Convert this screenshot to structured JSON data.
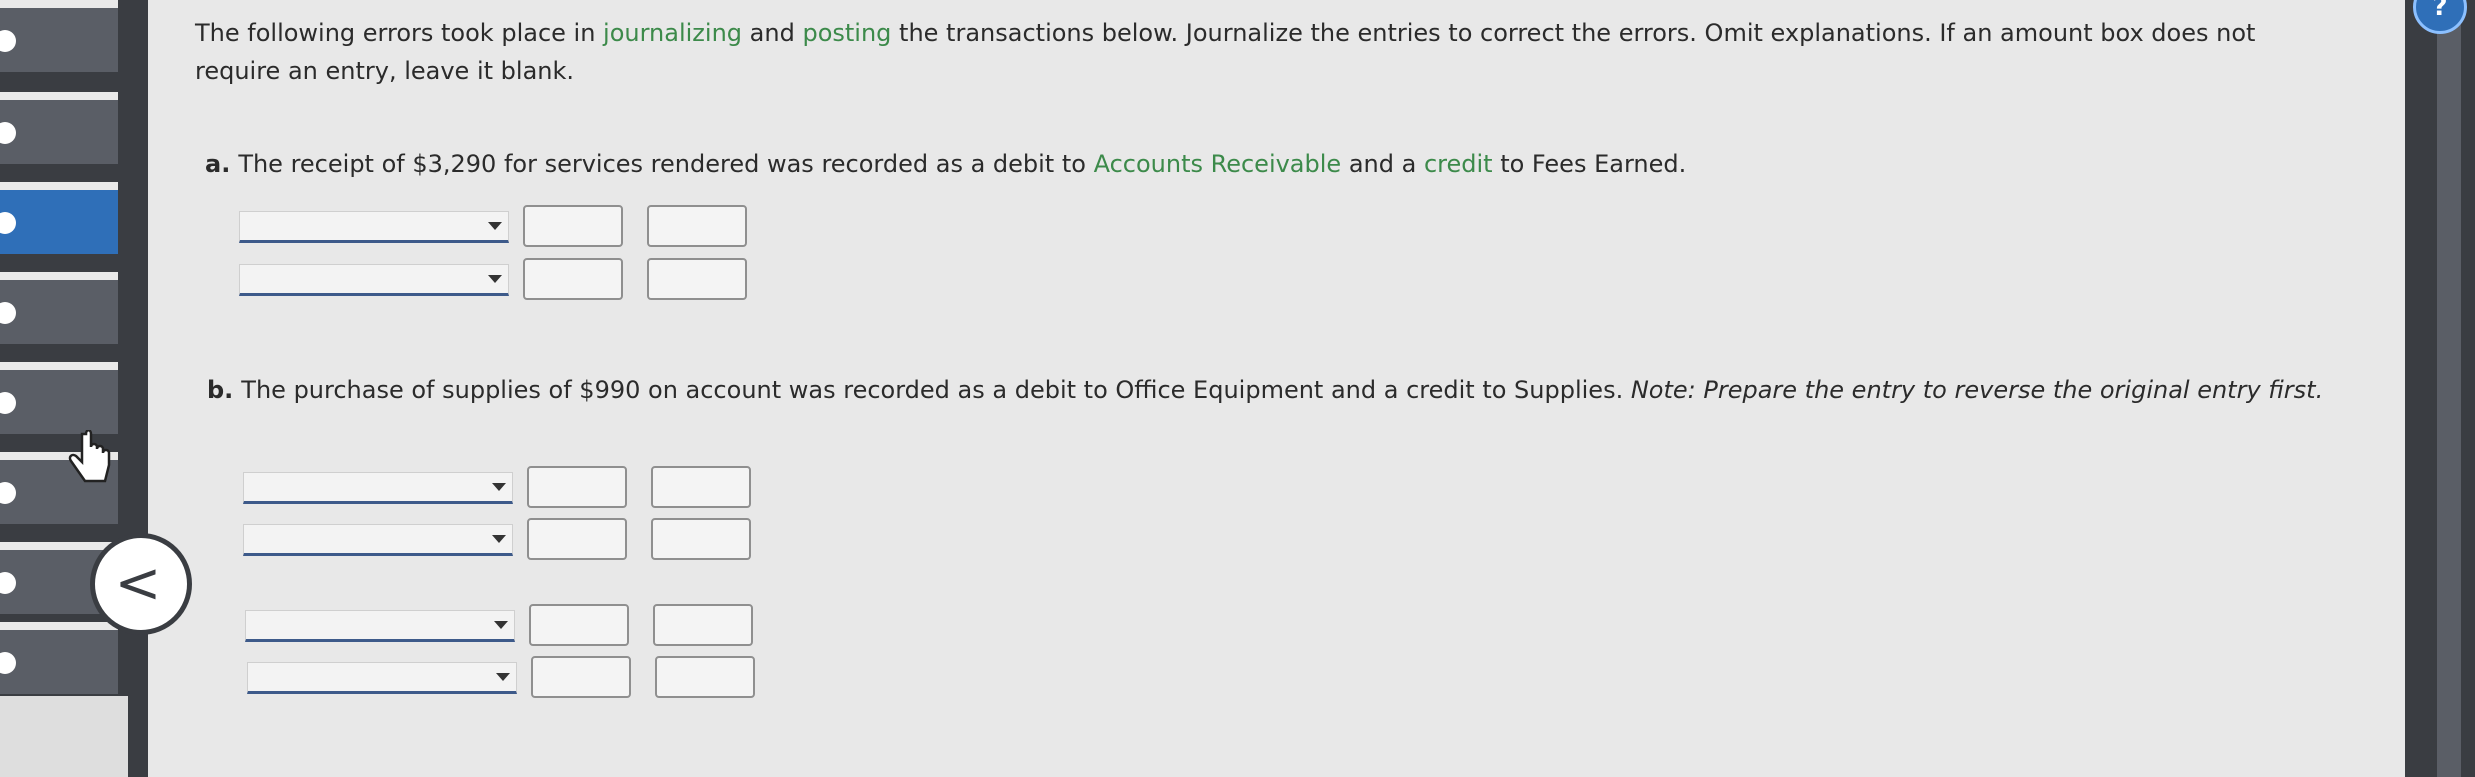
{
  "intro": {
    "part1": "The following errors took place in ",
    "link1": "journalizing",
    "part2": " and ",
    "link2": "posting",
    "part3": " the transactions below. Journalize the entries to correct the errors. Omit explanations. If an amount box does not require an entry, leave it blank."
  },
  "question_a": {
    "letter": "a.",
    "text1": "The receipt of $3,290 for services rendered was recorded as a debit to ",
    "link1": "Accounts Receivable",
    "text2": " and a ",
    "link2": "credit",
    "text3": " to Fees Earned."
  },
  "question_b": {
    "letter": "b.",
    "text": "The purchase of supplies of $990 on account was recorded as a debit to Office Equipment and a credit to Supplies. ",
    "note": "Note: Prepare the entry to reverse the original entry first."
  },
  "navigation": {
    "back_icon": "<",
    "help_icon": "?"
  },
  "colors": {
    "link_green": "#3c8a4a",
    "sidebar_dark": "#3a3d42",
    "active_blue": "#2f6fb8"
  }
}
